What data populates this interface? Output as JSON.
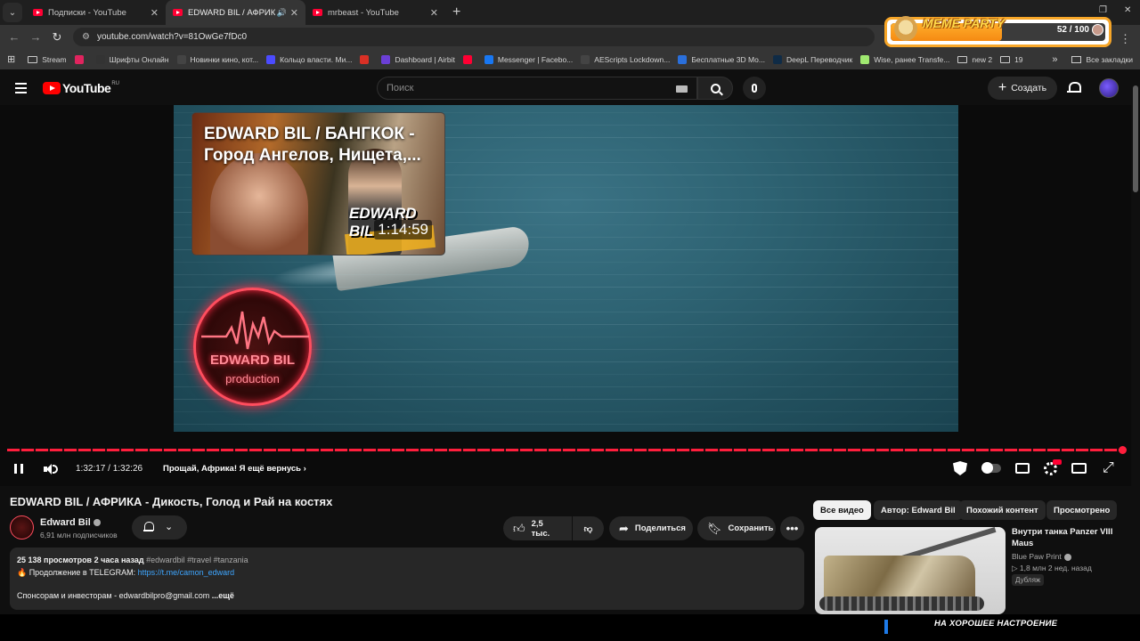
{
  "browser": {
    "tabs": [
      {
        "title": "Подписки - YouTube",
        "active": false
      },
      {
        "title": "EDWARD BIL / АФРИКА - Д",
        "active": true
      },
      {
        "title": "mrbeast - YouTube",
        "active": false
      }
    ],
    "new_tab": "+",
    "url": "youtube.com/watch?v=81OwGe7fDc0",
    "bookmarks": [
      {
        "label": "Stream",
        "icon": "folder-icon",
        "color": ""
      },
      {
        "label": "",
        "icon": "live-icon",
        "color": "#e0245e"
      },
      {
        "label": "Шрифты Онлайн",
        "icon": "font-icon",
        "color": "#333333"
      },
      {
        "label": "Новинки кино, кот...",
        "icon": "film-icon",
        "color": "#444444"
      },
      {
        "label": "Кольцо власти. Ми...",
        "icon": "p-icon",
        "color": "#4b4bff"
      },
      {
        "label": "",
        "icon": "gmail-icon",
        "color": "#d93025"
      },
      {
        "label": "Dashboard | Airbit",
        "icon": "airbit-icon",
        "color": "#6b3fd6"
      },
      {
        "label": "",
        "icon": "youtube-icon",
        "color": "#ff0033"
      },
      {
        "label": "Messenger | Facebo...",
        "icon": "facebook-icon",
        "color": "#1877f2"
      },
      {
        "label": "AEScripts Lockdown...",
        "icon": "aescripts-icon",
        "color": "#444444"
      },
      {
        "label": "Бесплатные 3D Мо...",
        "icon": "3d-icon",
        "color": "#2a6fdb"
      },
      {
        "label": "DeepL Переводчик",
        "icon": "deepl-icon",
        "color": "#0f2b46"
      },
      {
        "label": "Wise, ранее Transfe...",
        "icon": "wise-icon",
        "color": "#9fe870"
      },
      {
        "label": "new 2",
        "icon": "folder-icon",
        "color": ""
      },
      {
        "label": "19",
        "icon": "folder-icon",
        "color": ""
      }
    ],
    "bookmarks_overflow": "»",
    "all_bookmarks": "Все закладки"
  },
  "meme_party": {
    "title": "MEME PARTY",
    "count": "52 / 100",
    "progress": 0.52
  },
  "youtube": {
    "logo_text": "YouTube",
    "region": "RU",
    "search_placeholder": "Поиск",
    "create_label": "Создать"
  },
  "player": {
    "end_card": {
      "title": "EDWARD BIL / БАНГКОК - Город Ангелов, Нищета,...",
      "brand": "EDWARD BIL",
      "duration": "1:14:59"
    },
    "channel_logo": {
      "name": "EDWARD BIL",
      "sub": "production"
    },
    "current_time": "1:32:17",
    "duration": "1:32:26",
    "time_display": "1:32:17 / 1:32:26",
    "chapter": "Прощай, Африка! Я ещё вернусь",
    "progress": 0.998
  },
  "video": {
    "title": "EDWARD BIL / АФРИКА - Дикость, Голод и Рай на костях",
    "channel": "Edward Bil",
    "subscribers": "6,91 млн подписчиков",
    "likes": "2,5 тыс.",
    "share_label": "Поделиться",
    "save_label": "Сохранить",
    "description": {
      "stats": "25 138 просмотров  2 часа назад",
      "tags": "#edwardbil #travel #tanzania",
      "line1_prefix": "🔥 Продолжение в TELEGRAM: ",
      "line1_link": "https://t.me/camon_edward",
      "line2": "Спонсорам и инвесторам - edwardbilpro@gmail.com",
      "more": "...ещё"
    }
  },
  "sidebar": {
    "chips": [
      {
        "label": "Все видео",
        "selected": true
      },
      {
        "label": "Автор: Edward Bil",
        "selected": false
      },
      {
        "label": "Похожий контент",
        "selected": false
      },
      {
        "label": "Просмотрено",
        "selected": false
      }
    ],
    "recommendation": {
      "title": "Внутри танка Panzer VIII Maus",
      "channel": "Blue Paw Print",
      "meta": "▷ 1,8 млн  2 нед. назад",
      "badge": "Дубляж"
    }
  },
  "ticker": {
    "text": "НА ХОРОШЕЕ НАСТРОЕНИЕ"
  }
}
